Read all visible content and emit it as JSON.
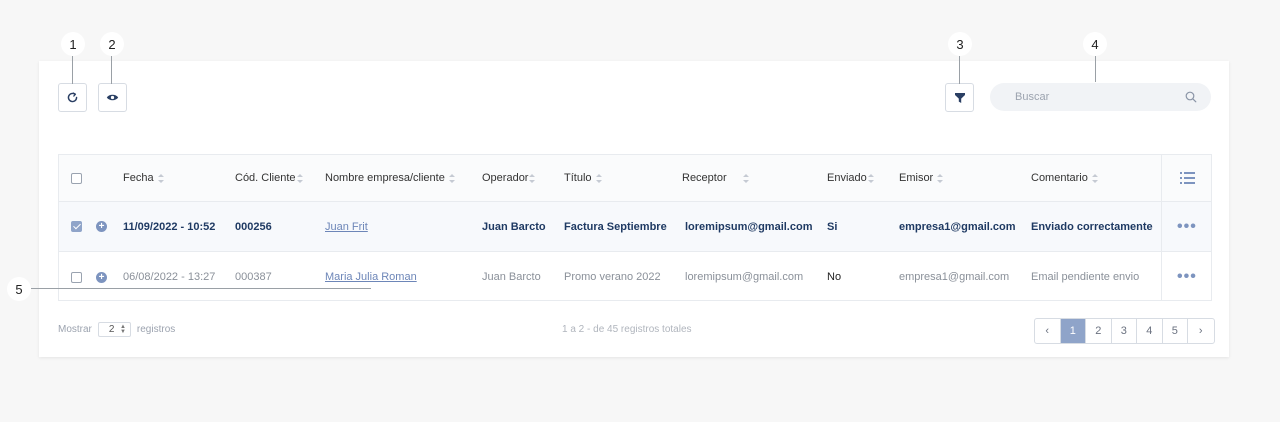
{
  "callouts": [
    "1",
    "2",
    "3",
    "4",
    "5"
  ],
  "toolbar": {
    "refresh_icon": "refresh-icon",
    "view_icon": "eye-icon",
    "filter_icon": "funnel-icon",
    "search_placeholder": "Buscar",
    "search_icon": "search-icon"
  },
  "table": {
    "headers": [
      "Fecha",
      "Cód. Cliente",
      "Nombre empresa/cliente",
      "Operador",
      "Título",
      "Receptor",
      "Enviado",
      "Emisor",
      "Comentario"
    ],
    "columns_icon": "list-columns-icon",
    "rows": [
      {
        "checked": true,
        "fecha": "11/09/2022 - 10:52",
        "cod": "000256",
        "nombre": "Juan Frit",
        "operador": "Juan Barcto",
        "titulo": "Factura Septiembre",
        "receptor": "loremipsum@gmail.com",
        "enviado": "Si",
        "emisor": "empresa1@gmail.com",
        "comentario": "Enviado correctamente"
      },
      {
        "checked": false,
        "fecha": "06/08/2022 - 13:27",
        "cod": "000387",
        "nombre": "Maria Julia Roman",
        "operador": "Juan Barcto",
        "titulo": "Promo verano 2022",
        "receptor": "loremipsum@gmail.com",
        "enviado": "No",
        "emisor": "empresa1@gmail.com",
        "comentario": "Email pendiente envio"
      }
    ],
    "row_actions": "•••"
  },
  "footer": {
    "mostrar": "Mostrar",
    "page_size": "2",
    "registros": "registros",
    "summary": "1 a 2 - de 45 registros totales"
  },
  "pagination": {
    "prev": "‹",
    "pages": [
      "1",
      "2",
      "3",
      "4",
      "5"
    ],
    "active": "1",
    "next": "›"
  },
  "colors": {
    "accent": "#8fa4c9",
    "text_dark": "#1f3a63",
    "border": "#e8ebef"
  }
}
